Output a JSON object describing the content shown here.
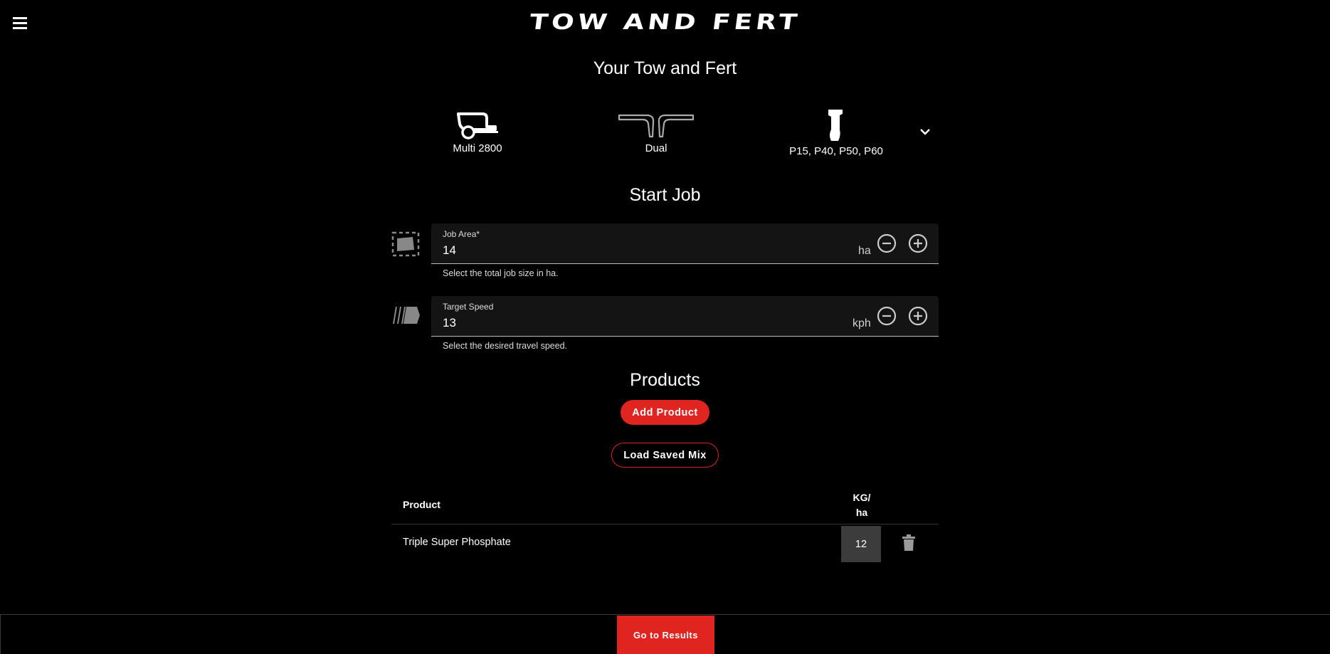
{
  "header": {
    "brand": "TOW AND FERT",
    "menu_icon": "hamburger-menu-icon"
  },
  "config": {
    "title": "Your Tow and Fert",
    "items": [
      {
        "label": "Multi 2800",
        "icon": "cart-icon"
      },
      {
        "label": "Dual",
        "icon": "dual-outlet-icon"
      },
      {
        "label": "P15, P40, P50, P60",
        "icon": "tine-icon"
      }
    ],
    "expand_icon": "chevron-down-icon"
  },
  "start_job": {
    "title": "Start Job",
    "job_area": {
      "label": "Job Area*",
      "value": "14",
      "unit": "ha",
      "hint": "Select the total job size in ha.",
      "icon": "field-area-icon"
    },
    "target_speed": {
      "label": "Target Speed",
      "value": "13",
      "unit": "kph",
      "hint": "Select the desired travel speed.",
      "icon": "speed-icon"
    }
  },
  "products": {
    "title": "Products",
    "add_label": "Add Product",
    "load_label": "Load Saved Mix",
    "columns": {
      "product": "Product",
      "rate_line1": "KG/",
      "rate_line2": "ha"
    },
    "rows": [
      {
        "product": "Triple Super Phosphate",
        "rate": "12"
      }
    ]
  },
  "footer": {
    "results_label": "Go to Results"
  },
  "colors": {
    "accent": "#e0241f",
    "background": "#000000",
    "field_bg": "#141414"
  }
}
